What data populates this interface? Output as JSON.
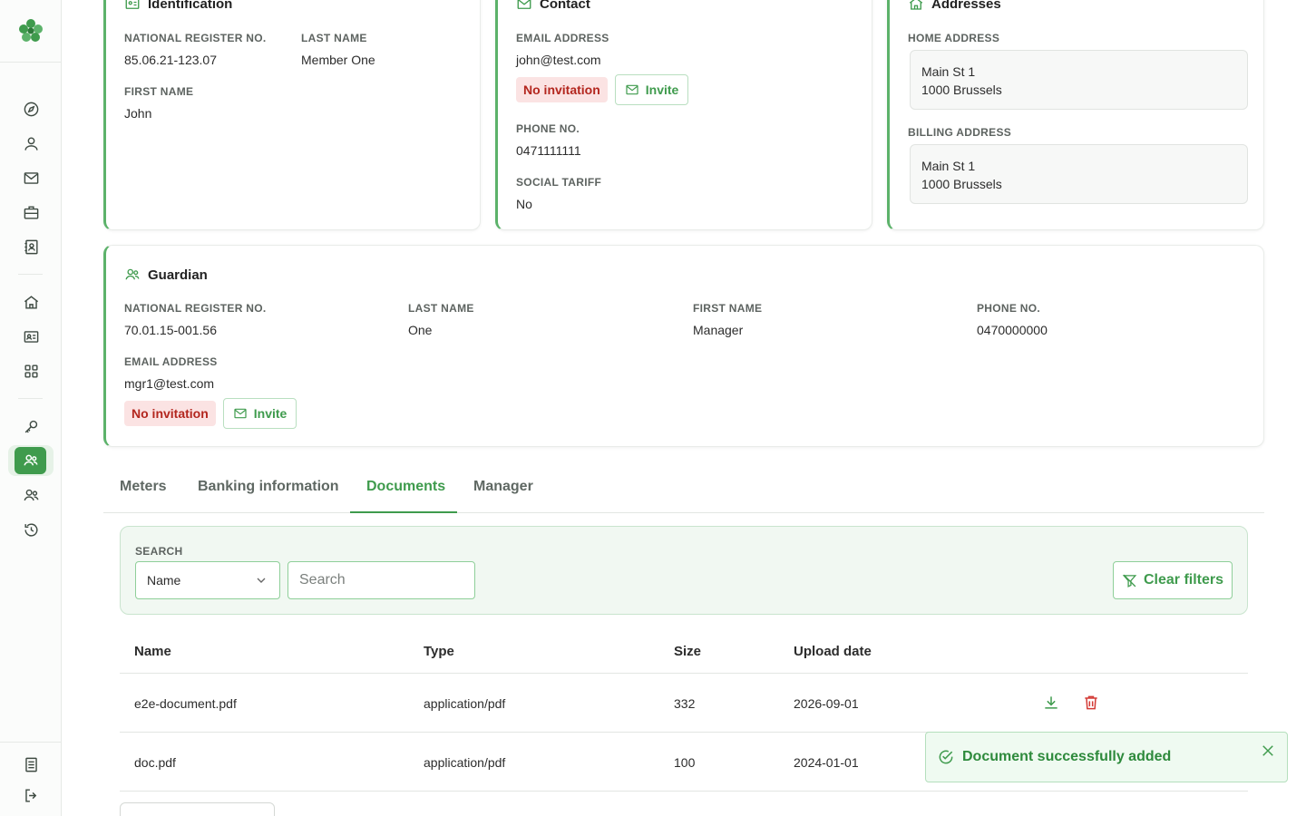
{
  "identification": {
    "title": "Identification",
    "national_register_label": "NATIONAL REGISTER NO.",
    "national_register_value": "85.06.21-123.07",
    "last_name_label": "LAST NAME",
    "last_name_value": "Member One",
    "first_name_label": "FIRST NAME",
    "first_name_value": "John"
  },
  "contact": {
    "title": "Contact",
    "email_label": "EMAIL ADDRESS",
    "email_value": "john@test.com",
    "invitation_status": "No invitation",
    "invite_label": "Invite",
    "phone_label": "PHONE NO.",
    "phone_value": "0471111111",
    "social_tariff_label": "SOCIAL TARIFF",
    "social_tariff_value": "No"
  },
  "addresses": {
    "title": "Addresses",
    "home_label": "HOME ADDRESS",
    "home_line1": "Main St 1",
    "home_line2": "1000 Brussels",
    "billing_label": "BILLING ADDRESS",
    "billing_line1": "Main St 1",
    "billing_line2": "1000 Brussels"
  },
  "guardian": {
    "title": "Guardian",
    "national_register_label": "NATIONAL REGISTER NO.",
    "national_register_value": "70.01.15-001.56",
    "last_name_label": "LAST NAME",
    "last_name_value": "One",
    "first_name_label": "FIRST NAME",
    "first_name_value": "Manager",
    "phone_label": "PHONE NO.",
    "phone_value": "0470000000",
    "email_label": "EMAIL ADDRESS",
    "email_value": "mgr1@test.com",
    "invitation_status": "No invitation",
    "invite_label": "Invite"
  },
  "tabs": [
    {
      "label": "Meters",
      "active": false
    },
    {
      "label": "Banking information",
      "active": false
    },
    {
      "label": "Documents",
      "active": true
    },
    {
      "label": "Manager",
      "active": false
    }
  ],
  "filter": {
    "search_label": "SEARCH",
    "field_selected": "Name",
    "search_placeholder": "Search",
    "clear_label": "Clear filters"
  },
  "documents": {
    "columns": [
      "Name",
      "Type",
      "Size",
      "Upload date"
    ],
    "rows": [
      {
        "name": "e2e-document.pdf",
        "type": "application/pdf",
        "size": "332",
        "upload_date": "2026-09-01"
      },
      {
        "name": "doc.pdf",
        "type": "application/pdf",
        "size": "100",
        "upload_date": "2024-01-01"
      }
    ]
  },
  "toast": {
    "message": "Document successfully added"
  },
  "colors": {
    "accent": "#3f9b4d",
    "danger": "#d33a35",
    "badge_bg": "#fbe3e3"
  },
  "icons": {
    "sidebar": [
      "compass-icon",
      "user-icon",
      "mail-icon",
      "briefcase-icon",
      "contact-book-icon",
      "home-icon",
      "id-card-icon",
      "grid-icon",
      "key-icon",
      "users-icon",
      "user-group-icon",
      "history-icon",
      "document-icon",
      "logout-icon"
    ]
  }
}
